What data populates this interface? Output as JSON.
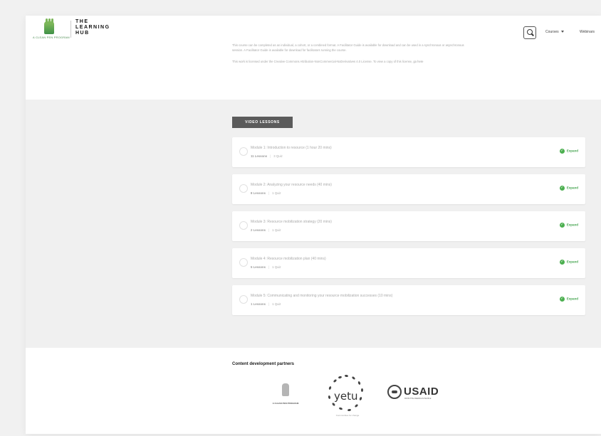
{
  "header": {
    "logo_org_text": "A CLEAN PEN PROGRAM",
    "logo_title": "THE LEARNING HUB",
    "nav": [
      {
        "label": "Courses"
      },
      {
        "label": "Webinars"
      }
    ]
  },
  "intro": {
    "paragraph_1": "This course can be completed as an individual, a cohort, or a combined format. A Facilitator Guide is available for download and can be used in a synchronous or asynchronous session. A Facilitator Guide is available for download for facilitators running the course.",
    "paragraph_2": "This work is licensed under the Creative Commons Attribution-NonCommercial-NoDerivatives 4.0 License. To view a copy of this license,",
    "link_text": "go here"
  },
  "section": {
    "label": "VIDEO LESSONS"
  },
  "modules": [
    {
      "title": "Module 1: Introduction to resource (1 hour 20 mins)",
      "lessons": "11 Lessons",
      "quizzes": "3 Quiz",
      "expand": "Expand"
    },
    {
      "title": "Module 2: Analyzing your resource needs (40 mins)",
      "lessons": "8 Lessons",
      "quizzes": "1 Quiz",
      "expand": "Expand"
    },
    {
      "title": "Module 3: Resource mobilization strategy (20 mins)",
      "lessons": "2 Lessons",
      "quizzes": "1 Quiz",
      "expand": "Expand"
    },
    {
      "title": "Module 4: Resource mobilization plan (40 mins)",
      "lessons": "5 Lessons",
      "quizzes": "1 Quiz",
      "expand": "Expand"
    },
    {
      "title": "Module 5: Communicating and monitoring your resource mobilization successes (10 mins)",
      "lessons": "1 Lessons",
      "quizzes": "1 Quiz",
      "expand": "Expand"
    }
  ],
  "partners": {
    "title": "Content development partners",
    "logo_1_text": "A CLEAN PEN PROGRAM",
    "logo_2_word": "yetu",
    "logo_2_tag": "Communities for change",
    "logo_3_word": "USAID",
    "logo_3_tag": "FROM THE AMERICAN PEOPLE"
  },
  "icons": {
    "search": "search-icon",
    "dropdown": "chevron-down-icon",
    "check": "check-circle-icon",
    "module_status": "circle-icon"
  },
  "colors": {
    "accent_green": "#4caf50",
    "section_label_bg": "#5b5b5b"
  }
}
